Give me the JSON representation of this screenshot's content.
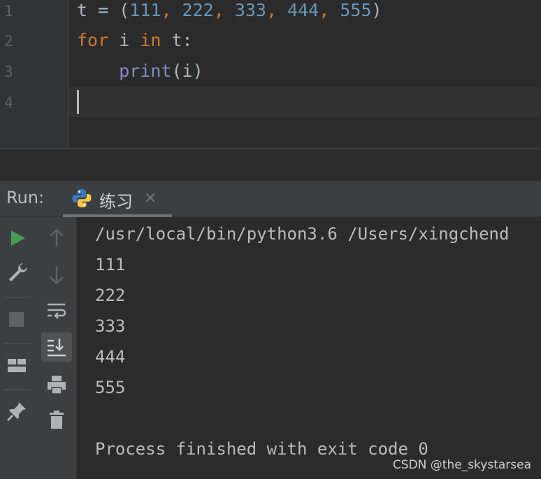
{
  "editor": {
    "line_numbers": [
      "1",
      "2",
      "3",
      "4"
    ],
    "line1": {
      "var": "t",
      "op": " = (",
      "n1": "111",
      "c1": ", ",
      "n2": "222",
      "c2": ", ",
      "n3": "333",
      "c3": ", ",
      "n4": "444",
      "c4": ", ",
      "n5": "555",
      "close": ")"
    },
    "line2": {
      "kw_for": "for",
      "var_i": " i ",
      "kw_in": "in",
      "rest": " t:"
    },
    "line3": {
      "indent": "    ",
      "func": "print",
      "args": "(i)"
    }
  },
  "run_panel": {
    "label": "Run:",
    "tab_label": "练习",
    "tab_close": "×",
    "toolbar_icons": [
      "run-icon",
      "wrench-icon",
      "stop-icon",
      "layout-icon",
      "pin-icon",
      "up-arrow-icon",
      "down-arrow-icon",
      "soft-wrap-icon",
      "scroll-to-end-icon",
      "print-icon",
      "trash-icon"
    ]
  },
  "console": {
    "lines": [
      "/usr/local/bin/python3.6 /Users/xingchend",
      "111",
      "222",
      "333",
      "444",
      "555",
      "",
      "Process finished with exit code 0"
    ]
  },
  "watermark": "CSDN @the_skystarsea",
  "colors": {
    "background": "#2b2b2b",
    "keyword": "#cc7832",
    "number": "#6897bb",
    "builtin": "#8888c6",
    "run_green": "#499c54"
  }
}
